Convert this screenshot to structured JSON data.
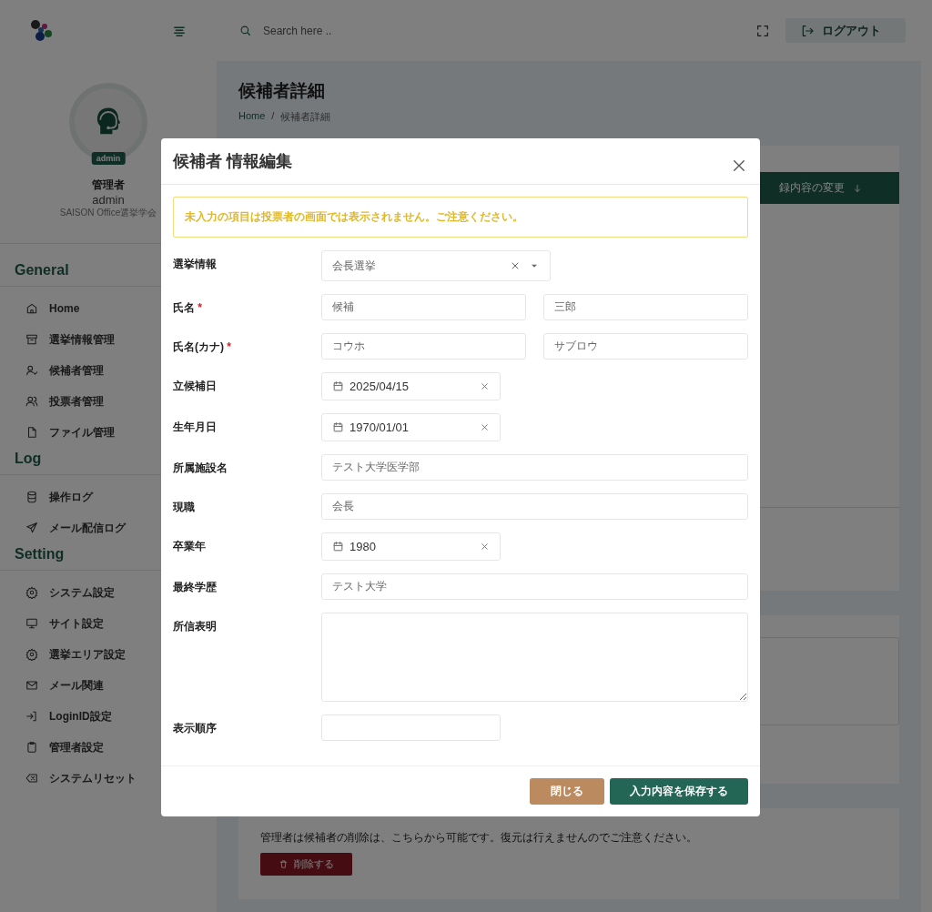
{
  "header": {
    "search_placeholder": "Search here ..",
    "logout": "ログアウト"
  },
  "profile": {
    "badge": "admin",
    "role": "管理者",
    "username": "admin",
    "organization": "SAISON Office選挙学会"
  },
  "sidebar": {
    "sections": [
      {
        "title": "General",
        "items": [
          {
            "label": "Home"
          },
          {
            "label": "選挙情報管理"
          },
          {
            "label": "候補者管理"
          },
          {
            "label": "投票者管理"
          },
          {
            "label": "ファイル管理"
          }
        ]
      },
      {
        "title": "Log",
        "items": [
          {
            "label": "操作ログ"
          },
          {
            "label": "メール配信ログ"
          }
        ]
      },
      {
        "title": "Setting",
        "items": [
          {
            "label": "システム設定"
          },
          {
            "label": "サイト設定"
          },
          {
            "label": "選挙エリア設定"
          },
          {
            "label": "メール関連"
          },
          {
            "label": "LoginID設定"
          },
          {
            "label": "管理者設定"
          },
          {
            "label": "システムリセット"
          }
        ]
      }
    ]
  },
  "page": {
    "title": "候補者詳細",
    "breadcrumb": [
      "Home",
      "候補者詳細"
    ],
    "breadcrumb_separator": "/",
    "edit_button": "録内容の変更",
    "delete_notice": "管理者は候補者の削除は、こちらから可能です。復元は行えませんのでご注意ください。",
    "delete_button": "削除する"
  },
  "modal": {
    "title": "候補者 情報編集",
    "alert": "未入力の項目は投票者の画面では表示されません。ご注意ください。",
    "required_mark": "*",
    "fields": [
      {
        "label": "選挙情報",
        "required": false,
        "kind": "select",
        "value": "会長選挙"
      },
      {
        "label": "氏名",
        "required": true,
        "kind": "pair",
        "values": [
          "候補",
          "三郎"
        ]
      },
      {
        "label": "氏名(カナ)",
        "required": true,
        "kind": "pair",
        "values": [
          "コウホ",
          "サブロウ"
        ]
      },
      {
        "label": "立候補日",
        "required": false,
        "kind": "date",
        "value": "2025/04/15"
      },
      {
        "label": "生年月日",
        "required": false,
        "kind": "date",
        "value": "1970/01/01"
      },
      {
        "label": "所属施設名",
        "required": false,
        "kind": "text",
        "value": "テスト大学医学部"
      },
      {
        "label": "現職",
        "required": false,
        "kind": "text",
        "value": "会長"
      },
      {
        "label": "卒業年",
        "required": false,
        "kind": "date",
        "value": "1980"
      },
      {
        "label": "最終学歴",
        "required": false,
        "kind": "text",
        "value": "テスト大学"
      },
      {
        "label": "所信表明",
        "required": false,
        "kind": "textarea"
      },
      {
        "label": "表示順序",
        "required": false,
        "kind": "short"
      }
    ],
    "buttons": {
      "close": "閉じる",
      "save": "入力内容を保存する"
    }
  }
}
